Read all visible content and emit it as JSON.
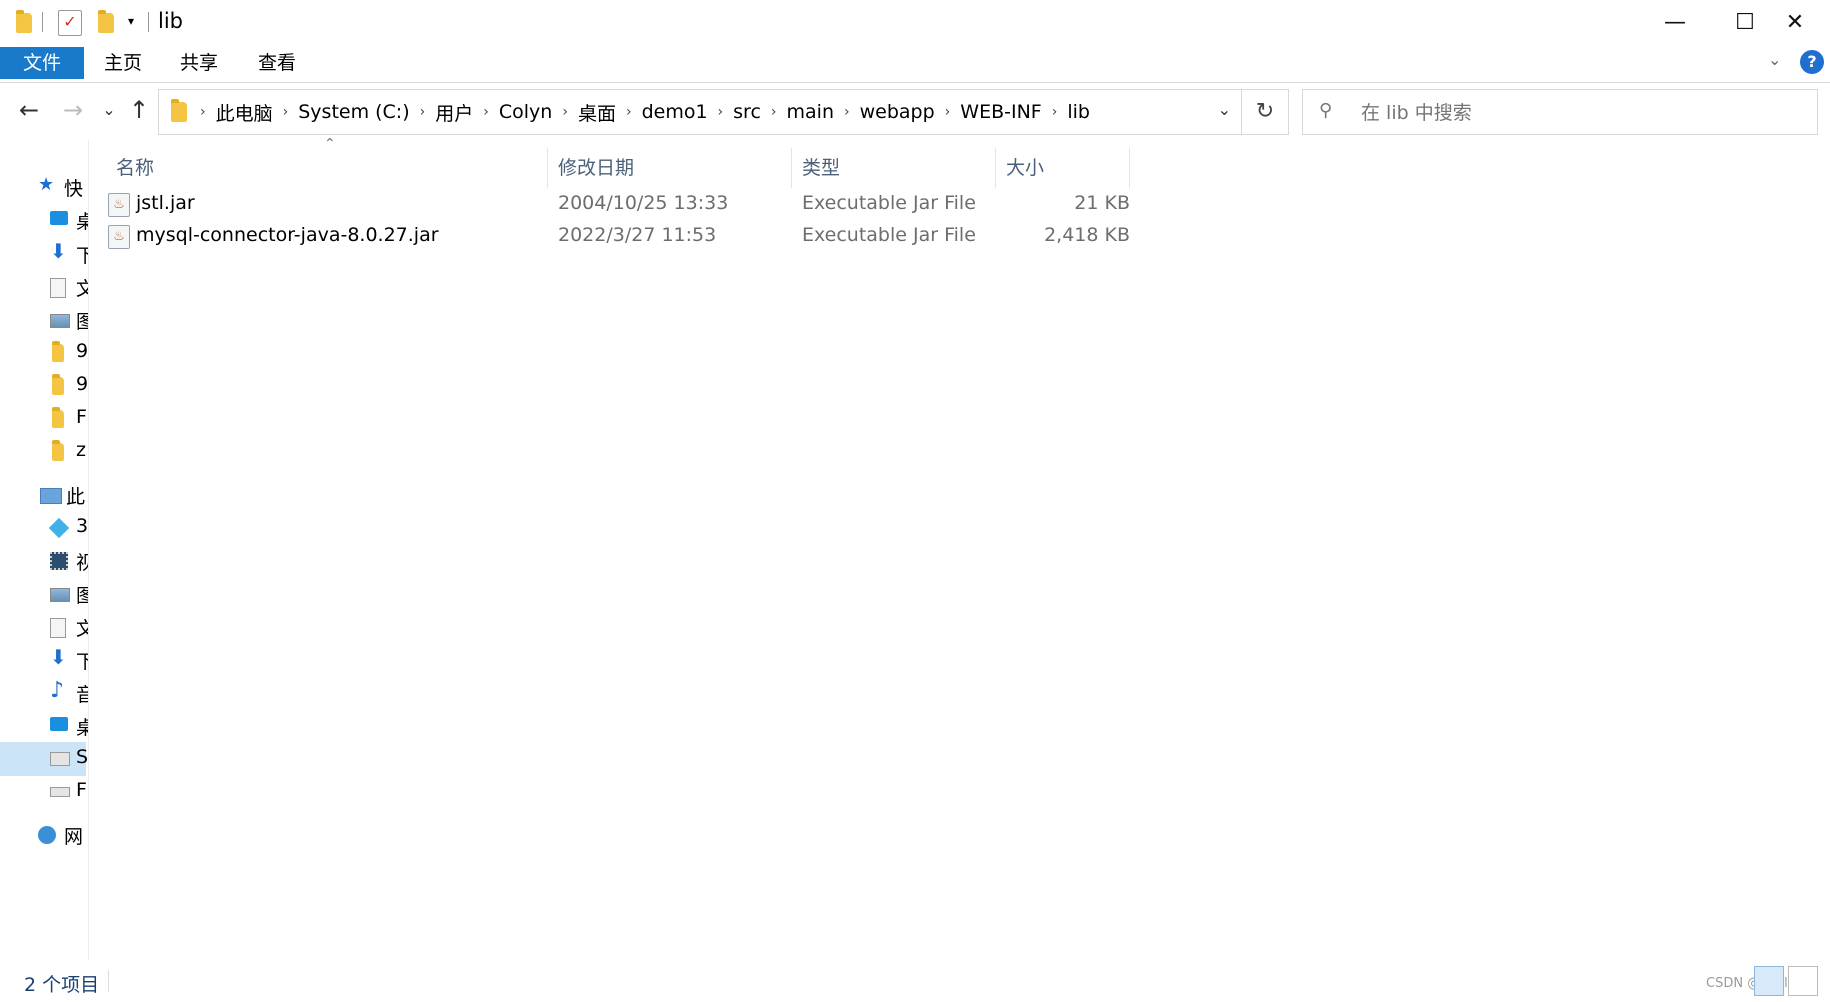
{
  "window": {
    "title": "lib",
    "minimize": "—",
    "maximize": "☐",
    "close": "✕"
  },
  "ribbon": {
    "tabs": [
      "文件",
      "主页",
      "共享",
      "查看"
    ],
    "help": "?",
    "colors": {
      "file_tab": "#1979ca"
    }
  },
  "nav": {
    "back": "←",
    "forward": "→",
    "recent": "⌄",
    "up": "↑",
    "breadcrumbs": [
      "此电脑",
      "System (C:)",
      "用户",
      "Colyn",
      "桌面",
      "demo1",
      "src",
      "main",
      "webapp",
      "WEB-INF",
      "lib"
    ],
    "refresh": "↻",
    "search_placeholder": "在 lib 中搜索"
  },
  "sidebar": {
    "items": [
      {
        "label": "快",
        "icon": "star-icon"
      },
      {
        "label": "桌",
        "icon": "desktop-icon"
      },
      {
        "label": "下",
        "icon": "download-icon"
      },
      {
        "label": "文",
        "icon": "document-icon"
      },
      {
        "label": "图",
        "icon": "picture-icon"
      },
      {
        "label": "9",
        "icon": "folder-icon"
      },
      {
        "label": "9",
        "icon": "folder-icon"
      },
      {
        "label": "F",
        "icon": "folder-icon"
      },
      {
        "label": "z",
        "icon": "folder-icon"
      },
      {
        "label": "此",
        "icon": "computer-icon"
      },
      {
        "label": "3",
        "icon": "3d-objects-icon"
      },
      {
        "label": "视",
        "icon": "video-icon"
      },
      {
        "label": "图",
        "icon": "picture-icon"
      },
      {
        "label": "文",
        "icon": "document-icon"
      },
      {
        "label": "下",
        "icon": "download-icon"
      },
      {
        "label": "音",
        "icon": "music-icon"
      },
      {
        "label": "桌",
        "icon": "desktop-icon"
      },
      {
        "label": "S",
        "icon": "drive-c-icon"
      },
      {
        "label": "F",
        "icon": "drive-icon"
      },
      {
        "label": "网",
        "icon": "network-icon"
      }
    ]
  },
  "columns": [
    "名称",
    "修改日期",
    "类型",
    "大小"
  ],
  "files": [
    {
      "name": "jstl.jar",
      "modified": "2004/10/25 13:33",
      "type": "Executable Jar File",
      "size": "21 KB"
    },
    {
      "name": "mysql-connector-java-8.0.27.jar",
      "modified": "2022/3/27 11:53",
      "type": "Executable Jar File",
      "size": "2,418 KB"
    }
  ],
  "status": {
    "count": "2 个项目",
    "watermark": "CSDN @|Ctrl"
  }
}
